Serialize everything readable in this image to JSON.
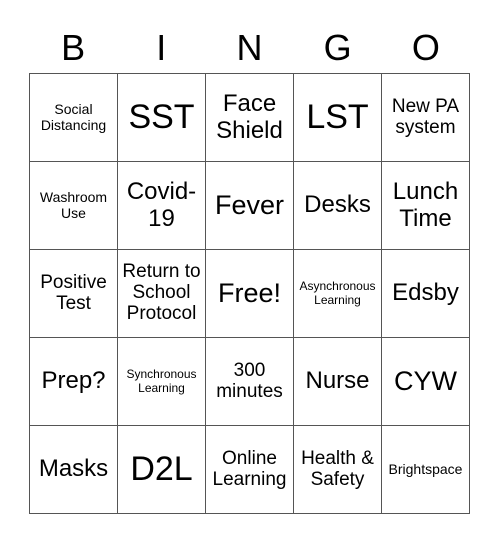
{
  "header": {
    "letters": [
      "B",
      "I",
      "N",
      "G",
      "O"
    ]
  },
  "grid": {
    "rows": [
      [
        {
          "text": "Social Distancing",
          "size": "sm"
        },
        {
          "text": "SST",
          "size": "xxl"
        },
        {
          "text": "Face Shield",
          "size": "lg"
        },
        {
          "text": "LST",
          "size": "xxl"
        },
        {
          "text": "New PA system",
          "size": "md"
        }
      ],
      [
        {
          "text": "Washroom Use",
          "size": "sm"
        },
        {
          "text": "Covid-19",
          "size": "lg"
        },
        {
          "text": "Fever",
          "size": "xl"
        },
        {
          "text": "Desks",
          "size": "lg"
        },
        {
          "text": "Lunch Time",
          "size": "lg"
        }
      ],
      [
        {
          "text": "Positive Test",
          "size": "md"
        },
        {
          "text": "Return to School Protocol",
          "size": "md"
        },
        {
          "text": "Free!",
          "size": "xl"
        },
        {
          "text": "Asynchronous Learning",
          "size": "xs"
        },
        {
          "text": "Edsby",
          "size": "lg"
        }
      ],
      [
        {
          "text": "Prep?",
          "size": "lg"
        },
        {
          "text": "Synchronous Learning",
          "size": "xs"
        },
        {
          "text": "300 minutes",
          "size": "md"
        },
        {
          "text": "Nurse",
          "size": "lg"
        },
        {
          "text": "CYW",
          "size": "xl"
        }
      ],
      [
        {
          "text": "Masks",
          "size": "lg"
        },
        {
          "text": "D2L",
          "size": "xxl"
        },
        {
          "text": "Online Learning",
          "size": "md"
        },
        {
          "text": "Health & Safety",
          "size": "md"
        },
        {
          "text": "Brightspace",
          "size": "sm"
        }
      ]
    ]
  }
}
